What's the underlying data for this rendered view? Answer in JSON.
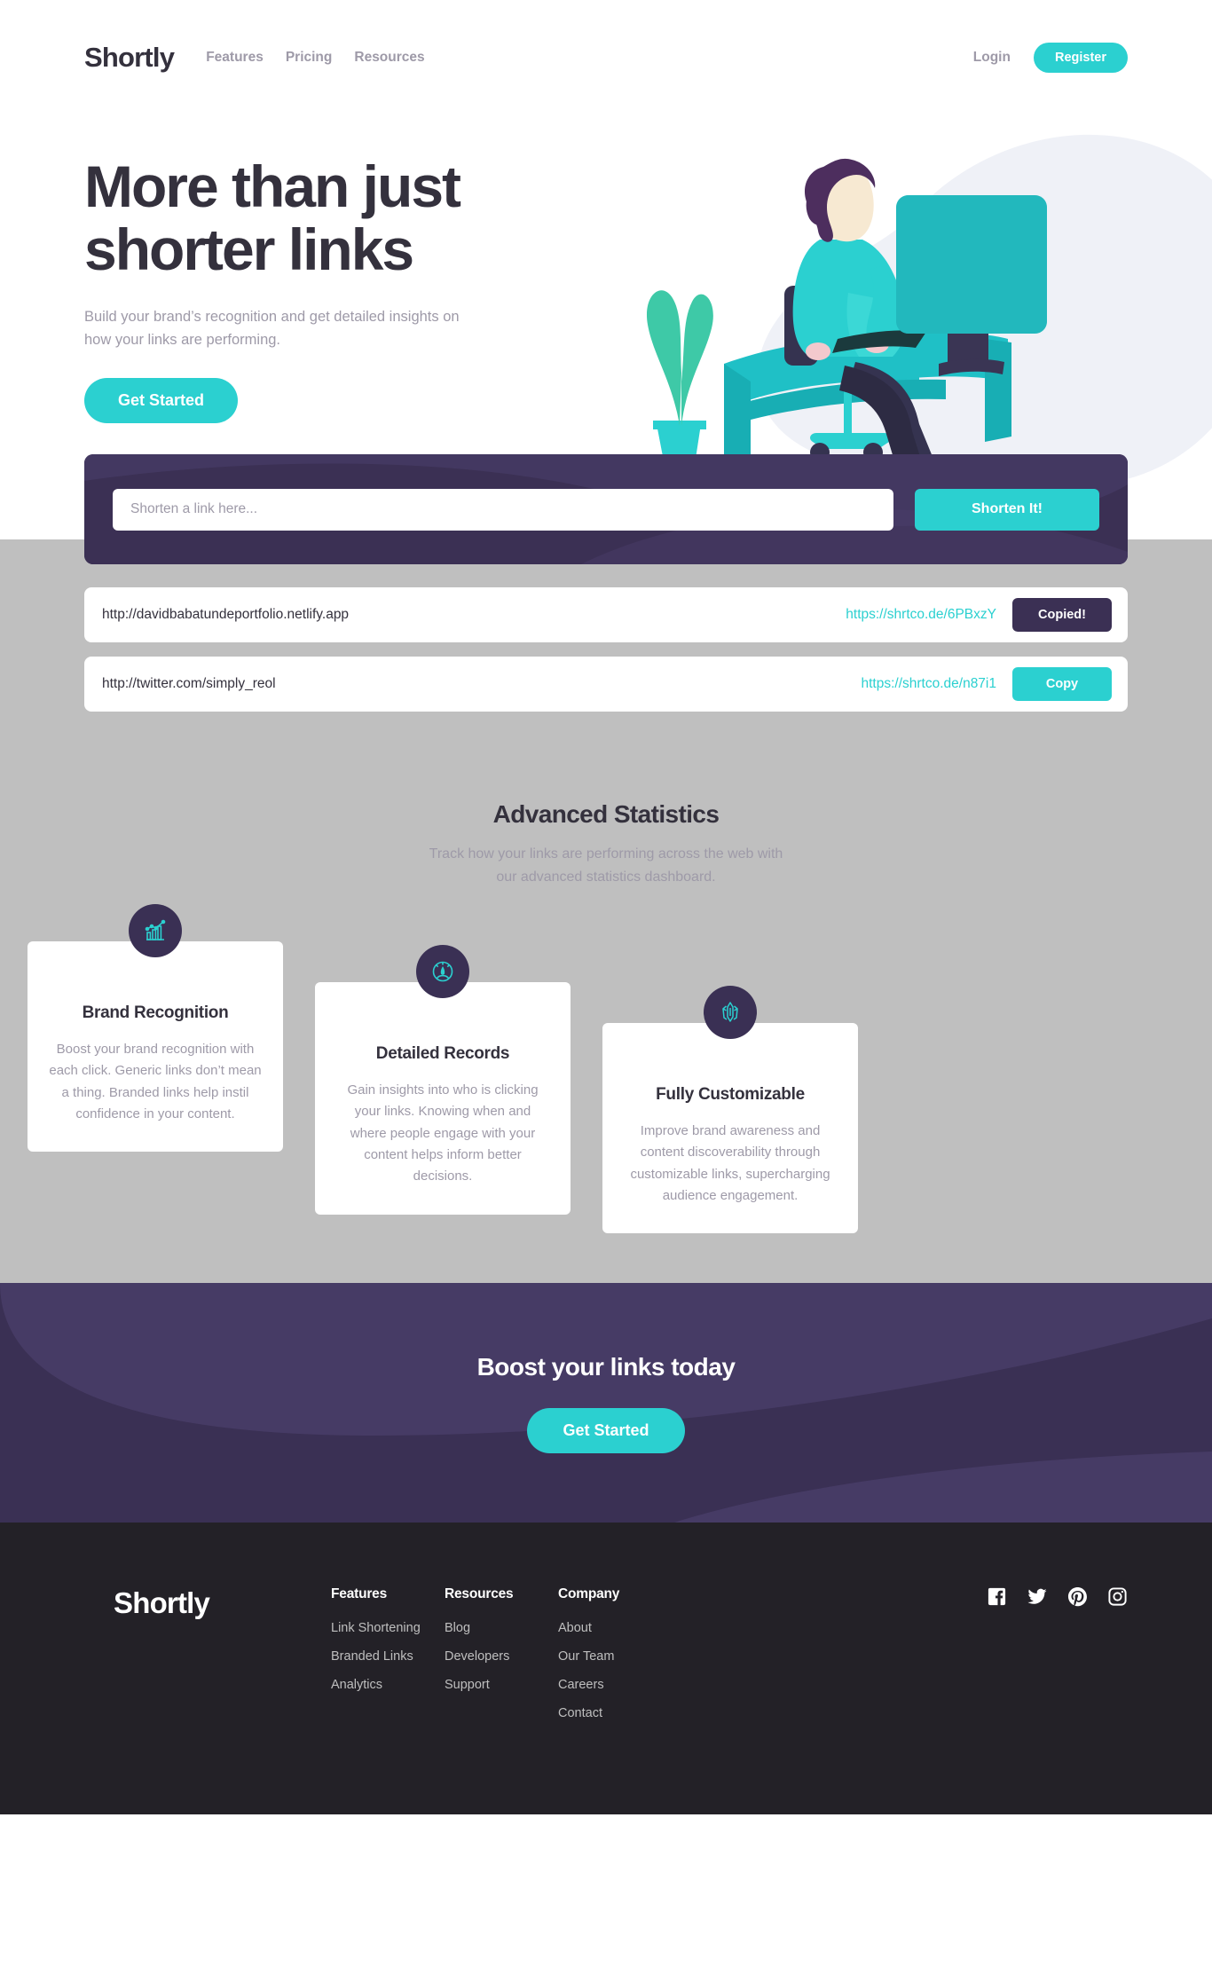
{
  "brand": {
    "name": "Shortly"
  },
  "header": {
    "nav": [
      {
        "label": "Features",
        "icon": "nav-features"
      },
      {
        "label": "Pricing",
        "icon": "nav-pricing"
      },
      {
        "label": "Resources",
        "icon": "nav-resources"
      }
    ],
    "login_label": "Login",
    "register_label": "Register"
  },
  "hero": {
    "title_line1": "More than just",
    "title_line2": "shorter links",
    "subtitle": "Build your brand’s recognition and get detailed insights on how your links are performing.",
    "cta_label": "Get Started",
    "illustration": "person-at-desk-illustration"
  },
  "shortener": {
    "placeholder": "Shorten a link here...",
    "value": "",
    "button_label": "Shorten It!"
  },
  "results": [
    {
      "long_url": "http://davidbabatundeportfolio.netlify.app",
      "short_url": "https://shrtco.de/6PBxzY",
      "button_label": "Copied!",
      "state": "copied"
    },
    {
      "long_url": "http://twitter.com/simply_reol",
      "short_url": "https://shrtco.de/n87i1",
      "button_label": "Copy",
      "state": "copy"
    }
  ],
  "stats": {
    "title": "Advanced Statistics",
    "subtitle": "Track how your links are performing across the web with our advanced statistics dashboard.",
    "cards": [
      {
        "icon": "bar-chart-icon",
        "title": "Brand Recognition",
        "desc": "Boost your brand recognition with each click. Generic links don’t mean a thing. Branded links help instil confidence in your content."
      },
      {
        "icon": "speedometer-icon",
        "title": "Detailed Records",
        "desc": "Gain insights into who is clicking your links. Knowing when and where people engage with your content helps inform better decisions."
      },
      {
        "icon": "pen-tools-icon",
        "title": "Fully Customizable",
        "desc": "Improve brand awareness and content discoverability through customizable links, supercharging audience engagement."
      }
    ]
  },
  "cta": {
    "title": "Boost your links today",
    "button_label": "Get Started"
  },
  "footer": {
    "logo": "Shortly",
    "columns": [
      {
        "title": "Features",
        "links": [
          "Link Shortening",
          "Branded Links",
          "Analytics"
        ]
      },
      {
        "title": "Resources",
        "links": [
          "Blog",
          "Developers",
          "Support"
        ]
      },
      {
        "title": "Company",
        "links": [
          "About",
          "Our Team",
          "Careers",
          "Contact"
        ]
      }
    ],
    "socials": [
      {
        "icon": "facebook-icon"
      },
      {
        "icon": "twitter-icon"
      },
      {
        "icon": "pinterest-icon"
      },
      {
        "icon": "instagram-icon"
      }
    ]
  },
  "colors": {
    "cyan": "#2bd0d0",
    "dark_violet": "#3a3054",
    "gray_text": "#9e9aa8",
    "dark_text": "#34313d",
    "footer_bg": "#232127",
    "section_gray": "#bfbfbf"
  }
}
